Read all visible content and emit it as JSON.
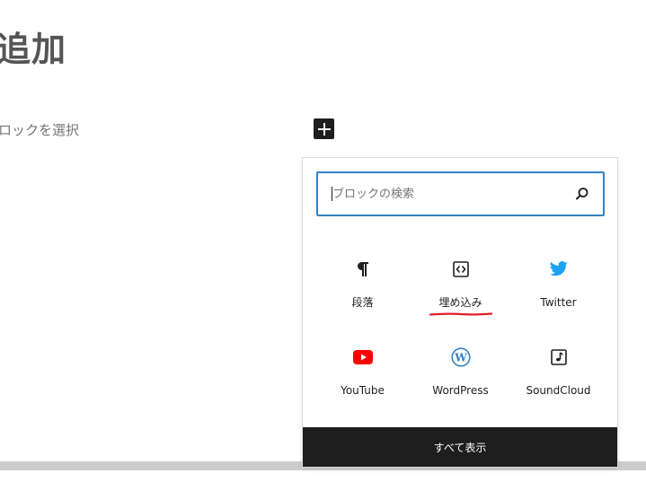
{
  "editor": {
    "title": "追加",
    "block_placeholder": "ロックを選択"
  },
  "inserter": {
    "search": {
      "placeholder": "ブロックの検索",
      "value": ""
    },
    "blocks": [
      {
        "label": "段落",
        "icon": "paragraph-icon"
      },
      {
        "label": "埋め込み",
        "icon": "embed-icon"
      },
      {
        "label": "Twitter",
        "icon": "twitter-icon",
        "color": "#1da1f2"
      },
      {
        "label": "YouTube",
        "icon": "youtube-icon",
        "color": "#ff0000"
      },
      {
        "label": "WordPress",
        "icon": "wordpress-icon",
        "color": "#3582c4"
      },
      {
        "label": "SoundCloud",
        "icon": "soundcloud-icon"
      }
    ],
    "browse_all_label": "すべて表示"
  },
  "colors": {
    "accent": "#3582c4",
    "dark": "#1e1e1e",
    "annotation": "#e0202a"
  }
}
